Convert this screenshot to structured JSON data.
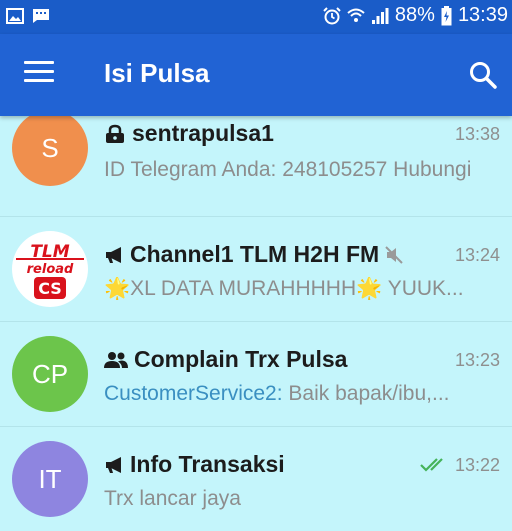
{
  "status": {
    "battery": "88%",
    "time": "13:39"
  },
  "appbar": {
    "title": "Isi Pulsa"
  },
  "chats": [
    {
      "name": "sentrapulsa1",
      "time": "13:38",
      "preview": "ID Telegram Anda: 248105257 Hubungi",
      "avatar_initials": "S",
      "avatar_color": "#f08f4d",
      "type_icon": "lock-icon"
    },
    {
      "name": "Channel1 TLM H2H FM",
      "time": "13:24",
      "preview": "🌟XL DATA MURAHHHHH🌟 YUUK...",
      "avatar_text_top": "TLM",
      "avatar_text_mid": "reload",
      "avatar_text_bottom": "CS",
      "type_icon": "megaphone-icon",
      "muted": true
    },
    {
      "name": "Complain Trx Pulsa",
      "time": "13:23",
      "preview_sender": "CustomerService2:",
      "preview": " Baik bapak/ibu,...",
      "avatar_initials": "CP",
      "avatar_color": "#6cc54b",
      "type_icon": "group-icon"
    },
    {
      "name": "Info Transaksi",
      "time": "13:22",
      "preview": "Trx lancar jaya",
      "avatar_initials": "IT",
      "avatar_color": "#8e85e0",
      "type_icon": "megaphone-icon",
      "read_status": "double-check-icon"
    }
  ]
}
